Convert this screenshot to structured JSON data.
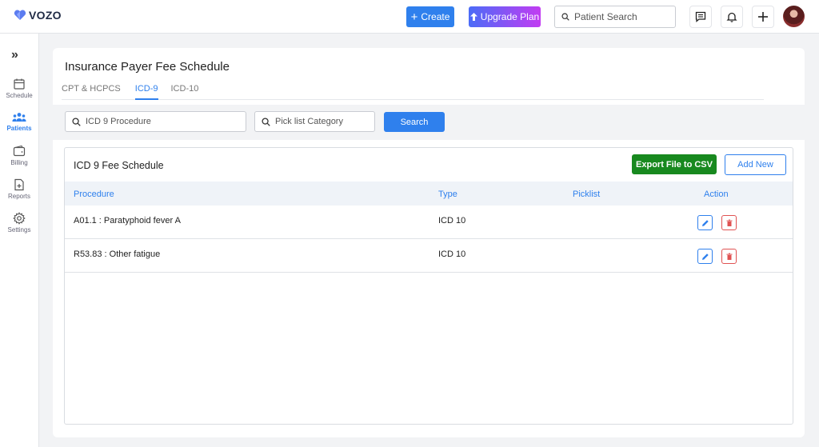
{
  "brand": {
    "name": "VOZO",
    "accent": "#2f80ed"
  },
  "header": {
    "create_label": "Create",
    "upgrade_label": "Upgrade Plan",
    "search_placeholder": "Patient Search"
  },
  "sidebar": {
    "items": [
      {
        "label": "Schedule",
        "icon": "calendar-icon"
      },
      {
        "label": "Patients",
        "icon": "patients-icon",
        "active": true
      },
      {
        "label": "Billing",
        "icon": "wallet-icon"
      },
      {
        "label": "Reports",
        "icon": "report-icon"
      },
      {
        "label": "Settings",
        "icon": "gear-icon"
      }
    ]
  },
  "page": {
    "title": "Insurance Payer Fee Schedule",
    "tabs": [
      {
        "label": "CPT & HCPCS"
      },
      {
        "label": "ICD-9",
        "active": true
      },
      {
        "label": "ICD-10"
      }
    ]
  },
  "filters": {
    "procedure_placeholder": "ICD 9 Procedure",
    "category_placeholder": "Pick list Category",
    "search_label": "Search"
  },
  "panel": {
    "title": "ICD 9 Fee Schedule",
    "export_label": "Export File to CSV",
    "add_label": "Add New",
    "columns": [
      "Procedure",
      "Type",
      "Picklist",
      "Action"
    ],
    "rows": [
      {
        "procedure": "A01.1 : Paratyphoid fever A",
        "type": "ICD 10",
        "picklist": ""
      },
      {
        "procedure": "R53.83 : Other fatigue",
        "type": "ICD 10",
        "picklist": ""
      }
    ]
  }
}
